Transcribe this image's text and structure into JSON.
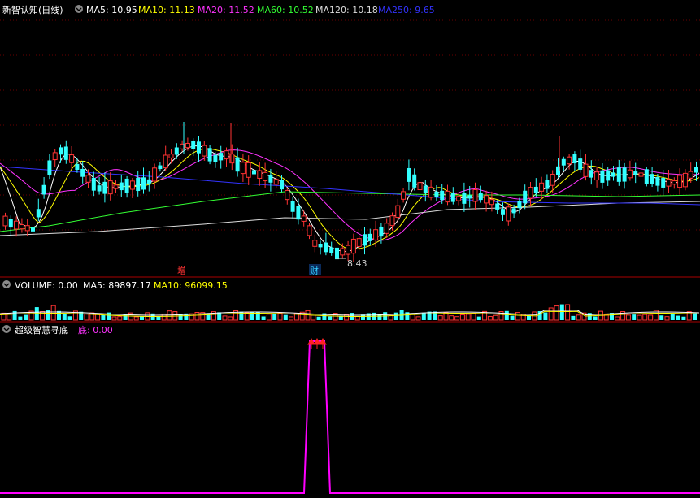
{
  "panels": {
    "price": {
      "title": "新智认知(日线)",
      "indicators": [
        {
          "label": "MA5: 10.95",
          "color": "#ffffff"
        },
        {
          "label": "MA10: 11.13",
          "color": "#ffff00"
        },
        {
          "label": "MA20: 11.52",
          "color": "#ff33ff"
        },
        {
          "label": "MA60: 10.52",
          "color": "#33ff33"
        },
        {
          "label": "MA120: 10.18",
          "color": "#dddddd"
        },
        {
          "label": "MA250: 9.65",
          "color": "#3333ff"
        }
      ],
      "low_label": "8.43",
      "markers": [
        {
          "text": "增",
          "color": "#ff3333"
        },
        {
          "text": "财",
          "color": "#33ccff"
        }
      ]
    },
    "volume": {
      "indicators": [
        {
          "label": "VOLUME: 0.00",
          "color": "#ffffff"
        },
        {
          "label": "MA5: 89897.17",
          "color": "#ffffff"
        },
        {
          "label": "MA10: 96099.15",
          "color": "#ffff00"
        }
      ]
    },
    "bottom": {
      "title": "超级智慧寻底",
      "value_label": "底: 0.00"
    }
  },
  "colors": {
    "up": "#ff3333",
    "down": "#33ffff",
    "grid": "#880000",
    "signal": "#ff00ff"
  }
}
